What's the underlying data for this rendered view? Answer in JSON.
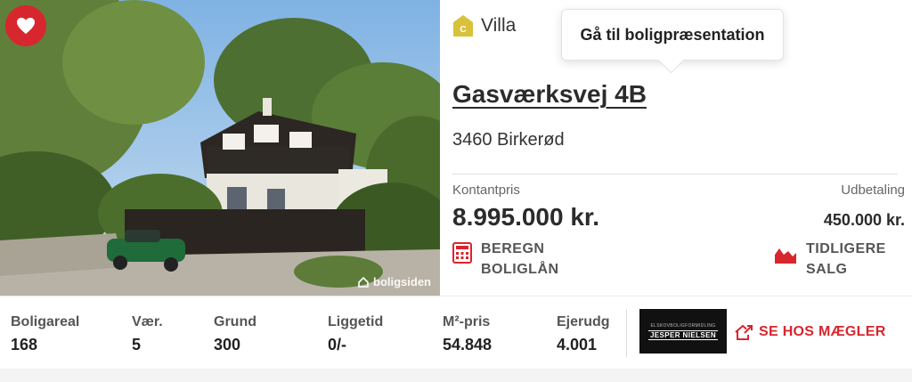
{
  "listing": {
    "favorite_icon": "heart-icon",
    "watermark": "boligsiden",
    "energy_label": "C",
    "property_type": "Villa",
    "tooltip": "Gå til boligpræsentation",
    "address": "Gasværksvej 4B",
    "city": "3460 Birkerød",
    "price_label": "Kontantpris",
    "price": "8.995.000 kr.",
    "down_payment_label": "Udbetaling",
    "down_payment": "450.000 kr.",
    "loan_action": "BEREGN BOLIGLÅN",
    "sales_action": "TIDLIGERE SALG"
  },
  "stats": [
    {
      "label": "Boligareal",
      "value": "168"
    },
    {
      "label": "Vær.",
      "value": "5"
    },
    {
      "label": "Grund",
      "value": "300"
    },
    {
      "label": "Liggetid",
      "value": "0/-"
    },
    {
      "label": "M²-pris",
      "value": "54.848"
    },
    {
      "label": "Ejerudg",
      "value": "4.001"
    }
  ],
  "broker": {
    "logo_top": "ELSKOVBOLIGFORMIDLING",
    "logo_name": "JESPER NIELSEN",
    "link_label": "SE HOS MÆGLER"
  },
  "colors": {
    "accent": "#d8262e",
    "energy": "#d9c23a"
  }
}
